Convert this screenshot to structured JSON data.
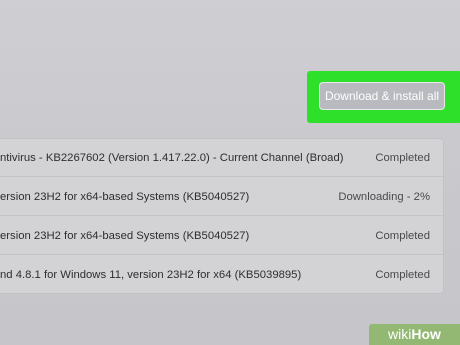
{
  "download_button": {
    "label": "Download & install all"
  },
  "highlight_color": "#2ee02a",
  "updates": [
    {
      "name": "ntivirus - KB2267602 (Version 1.417.22.0) - Current Channel (Broad)",
      "status": "Completed"
    },
    {
      "name": "ersion 23H2 for x64-based Systems (KB5040527)",
      "status": "Downloading - 2%"
    },
    {
      "name": "ersion 23H2 for x64-based Systems (KB5040527)",
      "status": "Completed"
    },
    {
      "name": "nd 4.8.1 for Windows 11, version 23H2 for x64 (KB5039895)",
      "status": "Completed"
    }
  ],
  "watermark": {
    "wiki": "wiki",
    "how": "How"
  }
}
